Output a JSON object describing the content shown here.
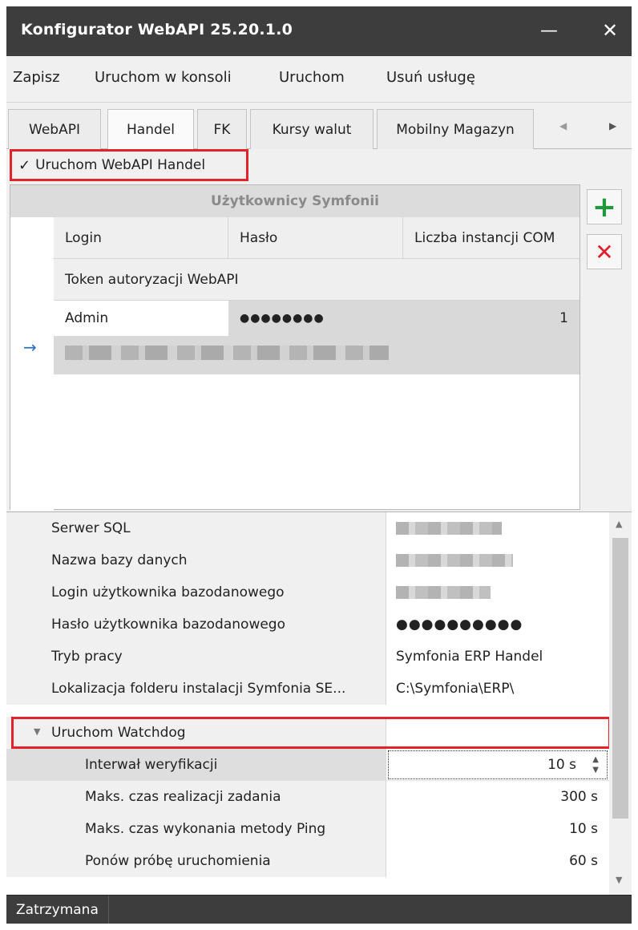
{
  "window": {
    "title": "Konfigurator WebAPI 25.20.1.0",
    "minimize_glyph": "—",
    "close_glyph": "✕"
  },
  "menu": [
    "Zapisz",
    "Uruchom w konsoli",
    "Uruchom",
    "Usuń usługę"
  ],
  "tabs": [
    "WebAPI",
    "Handel",
    "FK",
    "Kursy walut",
    "Mobilny Magazyn"
  ],
  "active_tab": "Handel",
  "run_checkbox": {
    "checked": true,
    "label": "Uruchom WebAPI Handel"
  },
  "users_grid": {
    "caption": "Użytkownicy Symfonii",
    "columns": [
      "Login",
      "Hasło",
      "Liczba instancji COM"
    ],
    "token_header": "Token autoryzacji WebAPI",
    "rows": [
      {
        "login": "Admin",
        "password": "●●●●●●●●",
        "com_instances": "1"
      }
    ]
  },
  "properties": [
    {
      "label": "Serwer SQL"
    },
    {
      "label": "Nazwa bazy danych"
    },
    {
      "label": "Login użytkownika bazodanowego"
    },
    {
      "label": "Hasło użytkownika bazodanowego",
      "value": "●●●●●●●●●●"
    },
    {
      "label": "Tryb pracy",
      "value": "Symfonia ERP Handel"
    },
    {
      "label": "Lokalizacja folderu instalacji Symfonia SE...",
      "value": "C:\\Symfonia\\ERP\\"
    },
    {
      "label": "Uruchom Watchdog",
      "checked": true
    },
    {
      "label": "Interwał weryfikacji",
      "value": "10 s"
    },
    {
      "label": "Maks. czas realizacji zadania",
      "value": "300 s"
    },
    {
      "label": "Maks. czas wykonania metody Ping",
      "value": "10 s"
    },
    {
      "label": "Ponów próbę uruchomienia",
      "value": "60 s"
    }
  ],
  "status": "Zatrzymana",
  "colors": {
    "titlebar": "#3d3d3d",
    "highlight": "#e1242a",
    "add": "#1f9a3a",
    "delete": "#e11d2a"
  }
}
